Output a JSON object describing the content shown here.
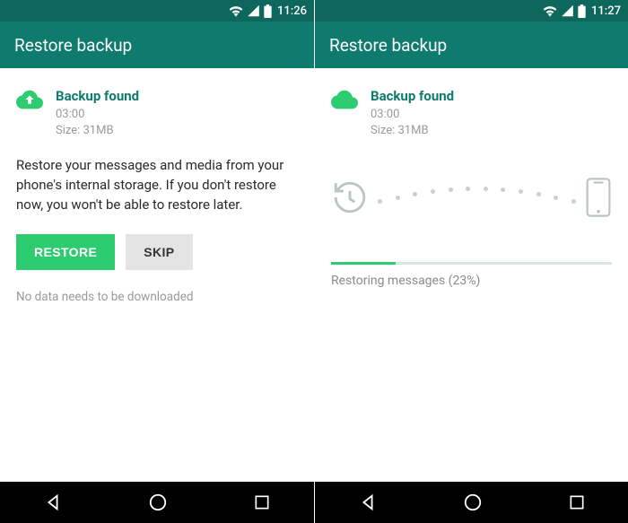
{
  "left": {
    "status": {
      "time": "11:26"
    },
    "appbar": {
      "title": "Restore backup"
    },
    "backup": {
      "title": "Backup found",
      "time": "03:00",
      "size": "Size: 31MB"
    },
    "body": {
      "text": "Restore your messages and media from your phone's internal storage. If you don't restore now, you won't be able to restore later.",
      "restore_label": "RESTORE",
      "skip_label": "SKIP",
      "footnote": "No data needs to be downloaded"
    }
  },
  "right": {
    "status": {
      "time": "11:27"
    },
    "appbar": {
      "title": "Restore backup"
    },
    "backup": {
      "title": "Backup found",
      "time": "03:00",
      "size": "Size: 31MB"
    },
    "progress": {
      "percent": 23,
      "label": "Restoring messages (23%)"
    }
  },
  "colors": {
    "teal": "#0f7b6f",
    "green": "#2ecc71"
  }
}
